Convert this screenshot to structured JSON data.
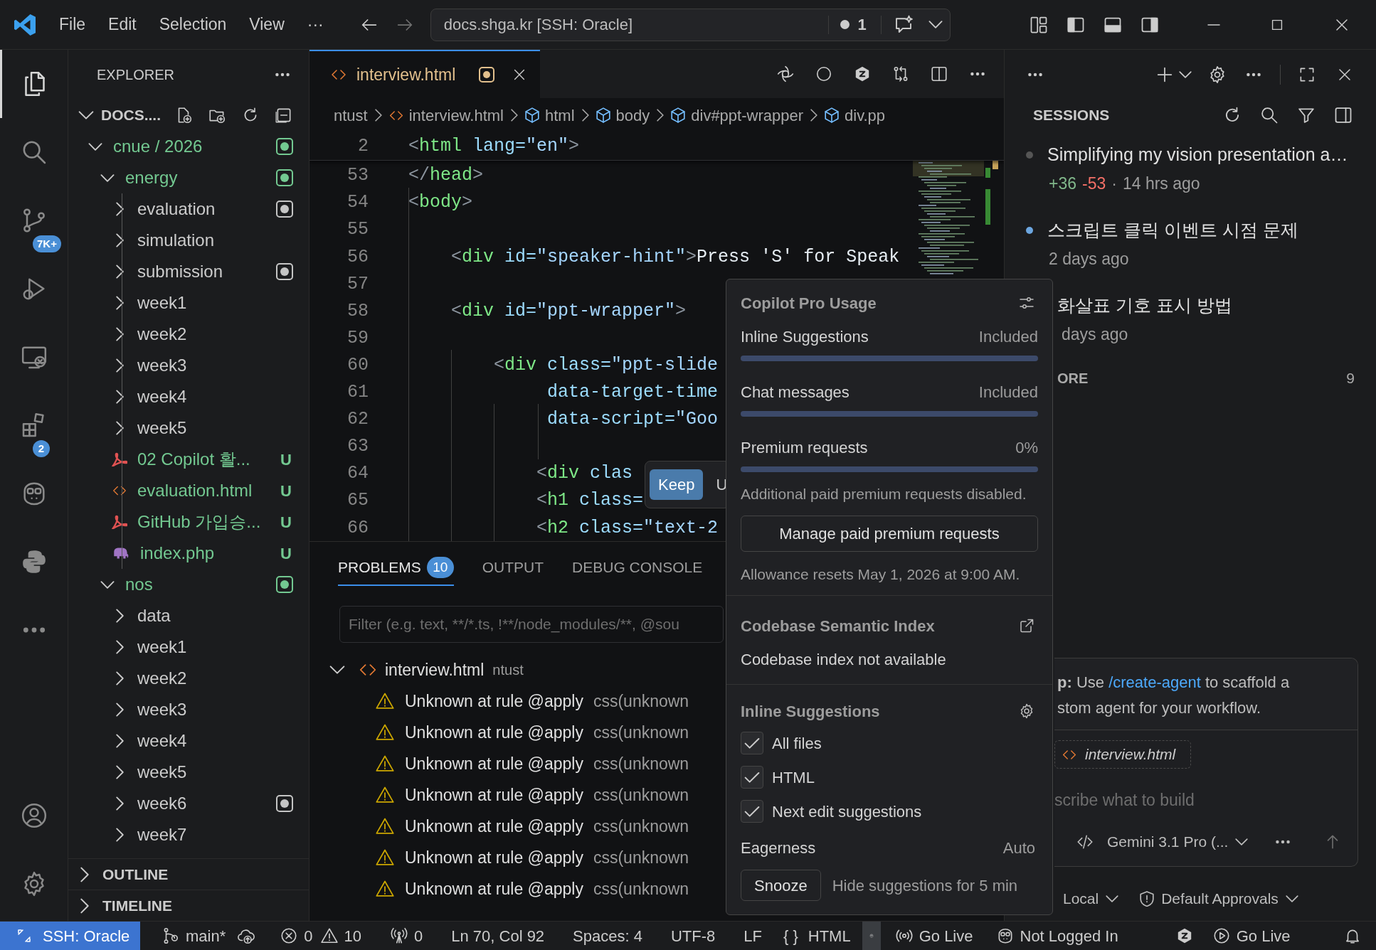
{
  "title_bar": {
    "menu": [
      "File",
      "Edit",
      "Selection",
      "View",
      "···"
    ],
    "command_center": "docs.shga.kr [SSH: Oracle]",
    "notification_count": "1"
  },
  "activity_bar": {
    "items": [
      {
        "kind": "explorer",
        "selected": true
      },
      {
        "kind": "search",
        "selected": false
      },
      {
        "kind": "source-control",
        "selected": false,
        "badge": "7K+"
      },
      {
        "kind": "run-debug",
        "selected": false
      },
      {
        "kind": "remote",
        "selected": false
      },
      {
        "kind": "extensions",
        "selected": false,
        "badge": "2"
      },
      {
        "kind": "copilot",
        "selected": false
      },
      {
        "kind": "python",
        "selected": false
      },
      {
        "kind": "more",
        "selected": false
      }
    ],
    "bottom": [
      {
        "kind": "account"
      },
      {
        "kind": "settings"
      }
    ]
  },
  "explorer": {
    "title": "EXPLORER",
    "root": "DOCS....",
    "tree": [
      {
        "label": "cnue / 2026",
        "kind": "folder",
        "expanded": true,
        "untracked": true,
        "color": "#73c991",
        "children": [
          {
            "label": "energy",
            "kind": "folder",
            "expanded": true,
            "untracked": true,
            "color": "#73c991",
            "show_guide": true,
            "children": [
              {
                "label": "evaluation",
                "kind": "folder",
                "expanded": false,
                "untracked": false,
                "color": "#c5c5c5"
              },
              {
                "label": "simulation",
                "kind": "folder",
                "expanded": false,
                "untracked": false
              },
              {
                "label": "submission",
                "kind": "folder",
                "expanded": false,
                "untracked": false,
                "color": "#c5c5c5"
              },
              {
                "label": "week1",
                "kind": "folder",
                "expanded": false,
                "untracked": false
              },
              {
                "label": "week2",
                "kind": "folder",
                "expanded": false,
                "untracked": false
              },
              {
                "label": "week3",
                "kind": "folder",
                "expanded": false,
                "untracked": false
              },
              {
                "label": "week4",
                "kind": "folder",
                "expanded": false,
                "untracked": false
              },
              {
                "label": "week5",
                "kind": "folder",
                "expanded": false,
                "untracked": false
              },
              {
                "label": "02 Copilot 활...",
                "kind": "pdf",
                "untracked": true,
                "letter": "U"
              },
              {
                "label": "evaluation.html",
                "kind": "html",
                "untracked": true,
                "letter": "U"
              },
              {
                "label": "GitHub 가입승...",
                "kind": "pdf",
                "untracked": true,
                "letter": "U"
              },
              {
                "label": "index.php",
                "kind": "php",
                "untracked": true,
                "letter": "U"
              }
            ]
          },
          {
            "label": "nos",
            "kind": "folder",
            "expanded": true,
            "untracked": true,
            "color": "#73c991",
            "children": [
              {
                "label": "data",
                "kind": "folder",
                "expanded": false,
                "untracked": false
              },
              {
                "label": "week1",
                "kind": "folder",
                "expanded": false,
                "untracked": false
              },
              {
                "label": "week2",
                "kind": "folder",
                "expanded": false,
                "untracked": false
              },
              {
                "label": "week3",
                "kind": "folder",
                "expanded": false,
                "untracked": false
              },
              {
                "label": "week4",
                "kind": "folder",
                "expanded": false,
                "untracked": false
              },
              {
                "label": "week5",
                "kind": "folder",
                "expanded": false,
                "untracked": false
              },
              {
                "label": "week6",
                "kind": "folder",
                "expanded": false,
                "untracked": false,
                "color": "#c5c5c5"
              },
              {
                "label": "week7",
                "kind": "folder",
                "expanded": false,
                "untracked": false
              }
            ]
          }
        ]
      }
    ],
    "sections": [
      {
        "label": "OUTLINE",
        "expanded": false
      },
      {
        "label": "TIMELINE",
        "expanded": false
      }
    ]
  },
  "editor": {
    "tabs": [
      {
        "label": "interview.html",
        "modified": true,
        "selected": true
      }
    ],
    "breadcrumb": [
      {
        "text": "ntust",
        "kind": "folder"
      },
      {
        "text": "interview.html",
        "kind": "file"
      },
      {
        "text": "html",
        "kind": "element"
      },
      {
        "text": "body",
        "kind": "element"
      },
      {
        "text": "div#ppt-wrapper",
        "kind": "element"
      },
      {
        "text": "div.pp",
        "kind": "element"
      }
    ],
    "sticky_line": {
      "number": "2",
      "tokens": [
        {
          "kind": "bracket",
          "text": "<"
        },
        {
          "kind": "tag",
          "text": "html"
        },
        {
          "kind": "attr",
          "text": " lang="
        },
        {
          "kind": "string",
          "text": "\"en\""
        },
        {
          "kind": "bracket",
          "text": ">"
        }
      ]
    },
    "lines": [
      {
        "number": "53",
        "tokens": [
          {
            "kind": "bracket",
            "text": "</"
          },
          {
            "kind": "tag",
            "text": "head"
          },
          {
            "kind": "bracket",
            "text": ">"
          }
        ]
      },
      {
        "number": "54",
        "tokens": [
          {
            "kind": "bracket",
            "text": "<"
          },
          {
            "kind": "tag",
            "text": "body"
          },
          {
            "kind": "bracket",
            "text": ">"
          }
        ]
      },
      {
        "number": "55"
      },
      {
        "number": "56",
        "tokens": [
          {
            "kind": "bracket",
            "text": "    <"
          },
          {
            "kind": "tag",
            "text": "div"
          },
          {
            "kind": "attr",
            "text": " id="
          },
          {
            "kind": "string",
            "text": "\"speaker-hint\""
          },
          {
            "kind": "bracket",
            "text": ">"
          },
          {
            "kind": "text",
            "text": "Press 'S' for Speak"
          }
        ]
      },
      {
        "number": "57"
      },
      {
        "number": "58",
        "tokens": [
          {
            "kind": "bracket",
            "text": "    <"
          },
          {
            "kind": "tag",
            "text": "div"
          },
          {
            "kind": "attr",
            "text": " id="
          },
          {
            "kind": "string",
            "text": "\"ppt-wrapper\""
          },
          {
            "kind": "bracket",
            "text": ">"
          }
        ]
      },
      {
        "number": "59"
      },
      {
        "number": "60",
        "tokens": [
          {
            "kind": "bracket",
            "text": "        <"
          },
          {
            "kind": "tag",
            "text": "div"
          },
          {
            "kind": "attr",
            "text": " class="
          },
          {
            "kind": "string",
            "text": "\"ppt-slide"
          }
        ]
      },
      {
        "number": "61",
        "tokens": [
          {
            "kind": "attr",
            "text": "             data-target-time"
          }
        ]
      },
      {
        "number": "62",
        "tokens": [
          {
            "kind": "attr",
            "text": "             data-script="
          },
          {
            "kind": "string",
            "text": "\"Goo"
          }
        ]
      },
      {
        "number": "63"
      },
      {
        "number": "64",
        "tokens": [
          {
            "kind": "bracket",
            "text": "            <"
          },
          {
            "kind": "tag",
            "text": "div"
          },
          {
            "kind": "attr",
            "text": " clas"
          }
        ]
      },
      {
        "number": "65",
        "tokens": [
          {
            "kind": "bracket",
            "text": "            <"
          },
          {
            "kind": "tag",
            "text": "h1"
          },
          {
            "kind": "attr",
            "text": " class="
          }
        ]
      },
      {
        "number": "66",
        "tokens": [
          {
            "kind": "bracket",
            "text": "            <"
          },
          {
            "kind": "tag",
            "text": "h2"
          },
          {
            "kind": "attr",
            "text": " class="
          },
          {
            "kind": "string",
            "text": "\"text-2"
          }
        ]
      }
    ],
    "inline_action": {
      "keep": "Keep",
      "undo": "U"
    }
  },
  "panel": {
    "tabs": [
      {
        "label": "PROBLEMS",
        "count": "10",
        "selected": true
      },
      {
        "label": "OUTPUT",
        "selected": false
      },
      {
        "label": "DEBUG CONSOLE",
        "selected": false
      }
    ],
    "filter_placeholder": "Filter (e.g. text, **/*.ts, !**/node_modules/**, @sou",
    "group": {
      "file": "interview.html",
      "folder": "ntust",
      "expanded": true,
      "problems": [
        {
          "kind": "warning",
          "message": "Unknown at rule @apply",
          "source": "css(unknown"
        },
        {
          "kind": "warning",
          "message": "Unknown at rule @apply",
          "source": "css(unknown"
        },
        {
          "kind": "warning",
          "message": "Unknown at rule @apply",
          "source": "css(unknown"
        },
        {
          "kind": "warning",
          "message": "Unknown at rule @apply",
          "source": "css(unknown"
        },
        {
          "kind": "warning",
          "message": "Unknown at rule @apply",
          "source": "css(unknown"
        },
        {
          "kind": "warning",
          "message": "Unknown at rule @apply",
          "source": "css(unknown"
        },
        {
          "kind": "warning",
          "message": "Unknown at rule @apply",
          "source": "css(unknown"
        }
      ]
    }
  },
  "sessions_panel": {
    "title": "SESSIONS",
    "sessions": [
      {
        "title": "Simplifying my vision presentation a…",
        "added": "+36",
        "removed": "-53",
        "separator": "·",
        "time": "14 hrs ago",
        "unread": false
      },
      {
        "title": "스크립트 클릭 이벤트 시점 문제",
        "time": "2 days ago",
        "unread": true
      },
      {
        "title": "화살표 기호 표시 방법",
        "time": "days ago"
      }
    ],
    "more": {
      "label": "ORE",
      "count": "9"
    },
    "chat": {
      "tip_prefix": "**p:** Use",
      "tip_link": "/create-agent",
      "tip_suffix": "to scaffold a",
      "tip_line2": "stom agent for your workflow.",
      "attachment": "interview.html",
      "placeholder": "scribe what to build",
      "model": "Gemini 3.1 Pro (...",
      "location": "Local",
      "approvals": "Default Approvals"
    }
  },
  "usage_popup": {
    "title": "Copilot Pro Usage",
    "quotas": [
      {
        "label": "Inline Suggestions",
        "value": "Included",
        "level": 0
      },
      {
        "label": "Chat messages",
        "value": "Included",
        "level": 0
      },
      {
        "label": "Premium requests",
        "value": "0%",
        "level": 0
      }
    ],
    "note": "Additional paid premium requests disabled.",
    "manage_button": "Manage paid premium requests",
    "reset": "Allowance resets May 1, 2026 at 9:00 AM.",
    "index_title": "Codebase Semantic Index",
    "index_status": "Codebase index not available",
    "inline_title": "Inline Suggestions",
    "options": [
      {
        "label": "All files",
        "checked": true
      },
      {
        "label": "HTML",
        "checked": true
      },
      {
        "label": "Next edit suggestions",
        "checked": true
      }
    ],
    "eagerness": {
      "label": "Eagerness",
      "value": "Auto"
    },
    "snooze": {
      "button": "Snooze",
      "hint": "Hide suggestions for 5 min"
    }
  },
  "status_bar": [
    {
      "kind": "remote",
      "text": "SSH: Oracle"
    },
    {
      "kind": "branch",
      "text": "main*"
    },
    {
      "kind": "sync"
    },
    {
      "kind": "errors",
      "text": "0"
    },
    {
      "kind": "warnings",
      "text": "10"
    },
    {
      "kind": "ports",
      "text": "0"
    },
    {
      "kind": "text",
      "text": "Ln 70, Col 92"
    },
    {
      "kind": "text",
      "text": "Spaces: 4"
    },
    {
      "kind": "text",
      "text": "UTF-8"
    },
    {
      "kind": "text",
      "text": "LF"
    },
    {
      "kind": "language",
      "icon": "{ }",
      "text": "HTML"
    },
    {
      "kind": "copilot"
    },
    {
      "kind": "broadcast",
      "text": "Go Live"
    },
    {
      "kind": "account",
      "text": "Not Logged In"
    },
    {
      "kind": "extension"
    },
    {
      "kind": "play",
      "text": "Go Live"
    },
    {
      "kind": "bell"
    }
  ]
}
